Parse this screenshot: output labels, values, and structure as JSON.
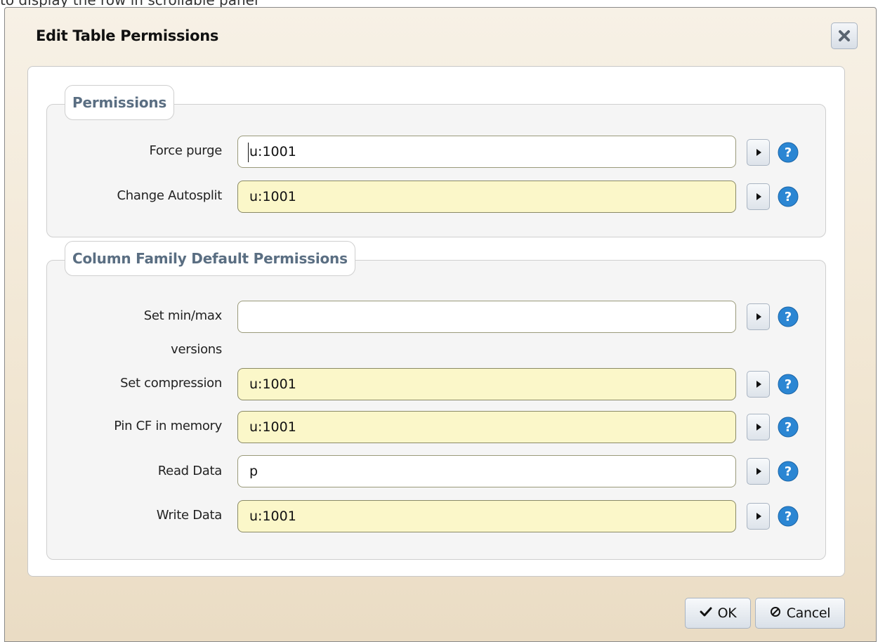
{
  "background_text": "to display the row in scrollable panel",
  "dialog": {
    "title": "Edit Table Permissions",
    "close_icon": "close-icon"
  },
  "permissions_section": {
    "legend": "Permissions",
    "rows": [
      {
        "label": "Force purge",
        "value": "u:1001",
        "highlighted": false,
        "focused": true
      },
      {
        "label": "Change Autosplit",
        "value": "u:1001",
        "highlighted": true,
        "focused": false
      }
    ]
  },
  "cf_section": {
    "legend": "Column Family Default Permissions",
    "rows": [
      {
        "label_line1": "Set min/max",
        "label_line2": "versions",
        "value": "",
        "highlighted": false
      },
      {
        "label": "Set compression",
        "value": "u:1001",
        "highlighted": true
      },
      {
        "label": "Pin CF in memory",
        "value": "u:1001",
        "highlighted": true
      },
      {
        "label": "Read Data",
        "value": "p",
        "highlighted": false
      },
      {
        "label": "Write Data",
        "value": "u:1001",
        "highlighted": true
      }
    ]
  },
  "row_icons": {
    "arrow": "triangle-right-icon",
    "help": "question-mark-icon"
  },
  "footer": {
    "ok_label": "OK",
    "ok_icon": "checkmark-icon",
    "cancel_label": "Cancel",
    "cancel_icon": "circle-slash-icon"
  },
  "colors": {
    "highlight_input": "#fbf7c9",
    "help_icon": "#2b86d3",
    "legend_text": "#5a6e82"
  }
}
